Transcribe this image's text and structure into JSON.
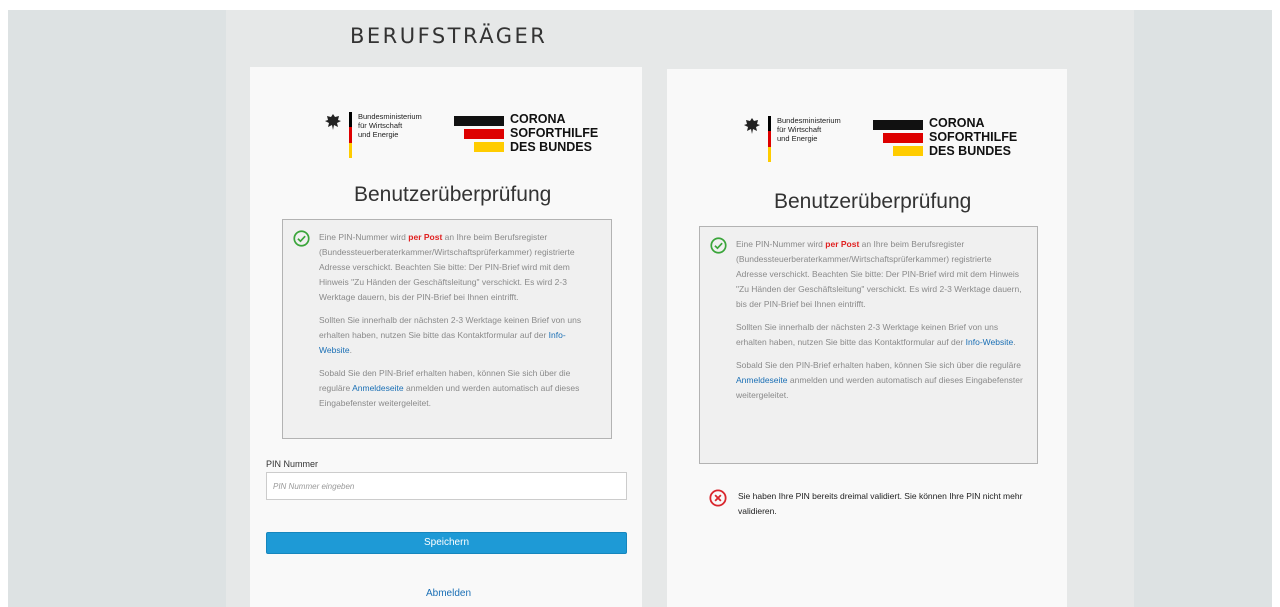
{
  "page": {
    "heading": "BERUFSTRÄGER"
  },
  "logos": {
    "ministry_lines": [
      "Bundesministerium",
      "für Wirtschaft",
      "und Energie"
    ],
    "corona_lines": [
      "CORONA",
      "SOFORTHILFE",
      "DES BUNDES"
    ],
    "flag_colors": [
      "#000000",
      "#dd0000",
      "#ffcc00"
    ]
  },
  "left_card": {
    "title": "Benutzerüberprüfung",
    "info": {
      "p1_before": "Eine PIN-Nummer wird ",
      "p1_highlight": "per Post",
      "p1_after": " an Ihre beim Berufsregister (Bundessteuerberaterkammer/Wirtschaftsprüferkammer) registrierte Adresse verschickt. Beachten Sie bitte: Der PIN-Brief wird mit dem Hinweis \"Zu Händen der Geschäftsleitung\" verschickt. Es wird 2-3 Werktage dauern, bis der PIN-Brief bei Ihnen eintrifft.",
      "p2_before": "Sollten Sie innerhalb der nächsten 2-3 Werktage keinen Brief von uns erhalten haben, nutzen Sie bitte das Kontaktformular auf der ",
      "p2_link": "Info-Website",
      "p2_after": ".",
      "p3_before": "Sobald Sie den PIN-Brief erhalten haben, können Sie sich über die reguläre ",
      "p3_link": "Anmeldeseite",
      "p3_after": " anmelden und werden automatisch auf dieses Eingabefenster weitergeleitet."
    },
    "pin_label": "PIN Nummer",
    "pin_placeholder": "PIN Nummer eingeben",
    "pin_value": "",
    "save_label": "Speichern",
    "logout_label": "Abmelden"
  },
  "right_card": {
    "title": "Benutzerüberprüfung",
    "info": {
      "p1_before": "Eine PIN-Nummer wird ",
      "p1_highlight": "per Post",
      "p1_after": " an Ihre beim Berufsregister (Bundessteuerberaterkammer/Wirtschaftsprüferkammer) registrierte Adresse verschickt. Beachten Sie bitte: Der PIN-Brief wird mit dem Hinweis \"Zu Händen der Geschäftsleitung\" verschickt. Es wird 2-3 Werktage dauern, bis der PIN-Brief bei Ihnen eintrifft.",
      "p2_before": "Sollten Sie innerhalb der nächsten 2-3 Werktage keinen Brief von uns erhalten haben, nutzen Sie bitte das Kontaktformular auf der ",
      "p2_link": "Info-Website",
      "p2_after": ".",
      "p3_before": "Sobald Sie den PIN-Brief erhalten haben, können Sie sich über die reguläre ",
      "p3_link": "Anmeldeseite",
      "p3_after": " anmelden und werden automatisch auf dieses Eingabefenster weitergeleitet."
    },
    "error_text": "Sie haben Ihre PIN bereits dreimal validiert. Sie können Ihre PIN nicht mehr validieren."
  },
  "colors": {
    "accent_button": "#1e9ad6",
    "link": "#1a6fb5",
    "highlight_red": "#e02020",
    "success_green": "#3aa53a",
    "error_red": "#d9262d"
  },
  "icons": {
    "success": "check-circle-icon",
    "error": "x-circle-icon",
    "emblem": "federal-eagle-icon"
  }
}
